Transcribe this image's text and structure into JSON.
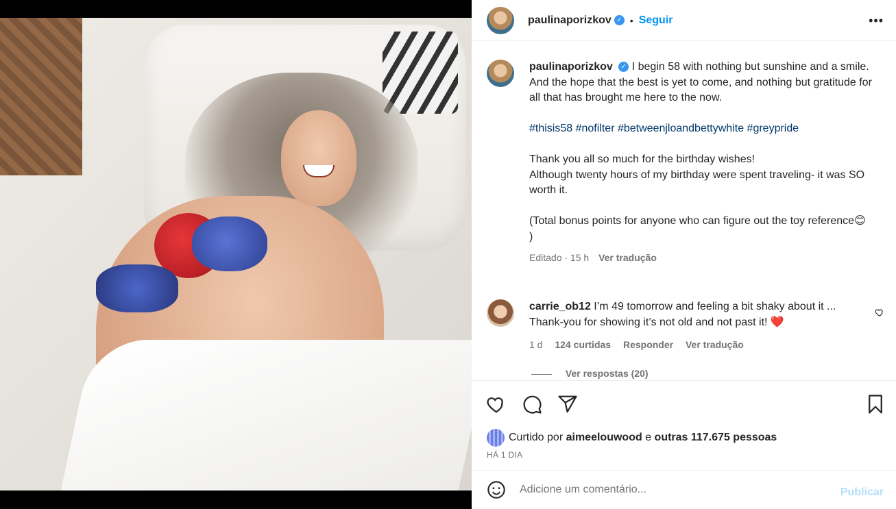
{
  "post": {
    "username": "paulinaporizkov",
    "follow_label": "Seguir",
    "more_label": "•••",
    "caption_lines": [
      "I begin 58 with nothing but sunshine and a smile.",
      "And the hope that the best is yet to come, and nothing but gratitude for all that has brought me here to the now.",
      "#thisis58 #nofilter #betweenjloandbettywhite #greypride",
      "Thank you all so much for the birthday wishes!",
      "Although twenty hours of my birthday were spent traveling- it was SO worth it.",
      "(Total bonus points for anyone who can figure out the toy reference😊 )"
    ],
    "caption_meta": "Editado · 15 h",
    "translate_label": "Ver tradução"
  },
  "comment": {
    "username": "carrie_ob12",
    "text": "I’m 49 tomorrow and feeling a bit shaky about it ... Thank-you for showing it’s not old and not past it! ❤️",
    "age": "1 d",
    "likes": "124 curtidas",
    "reply_label": "Responder",
    "translate_label": "Ver tradução",
    "replies_label": "Ver respostas (20)"
  },
  "likes": {
    "prefix": "Curtido por",
    "liker": "aimeelouwood",
    "middle": "e",
    "others": "outras 117.675 pessoas"
  },
  "time_ago": "HÁ 1 DIA",
  "add_comment": {
    "placeholder": "Adicione um comentário...",
    "post_label": "Publicar"
  },
  "colors": {
    "link": "#0095f6",
    "hashtag": "#00376b",
    "post_disabled": "#b2dffc"
  }
}
